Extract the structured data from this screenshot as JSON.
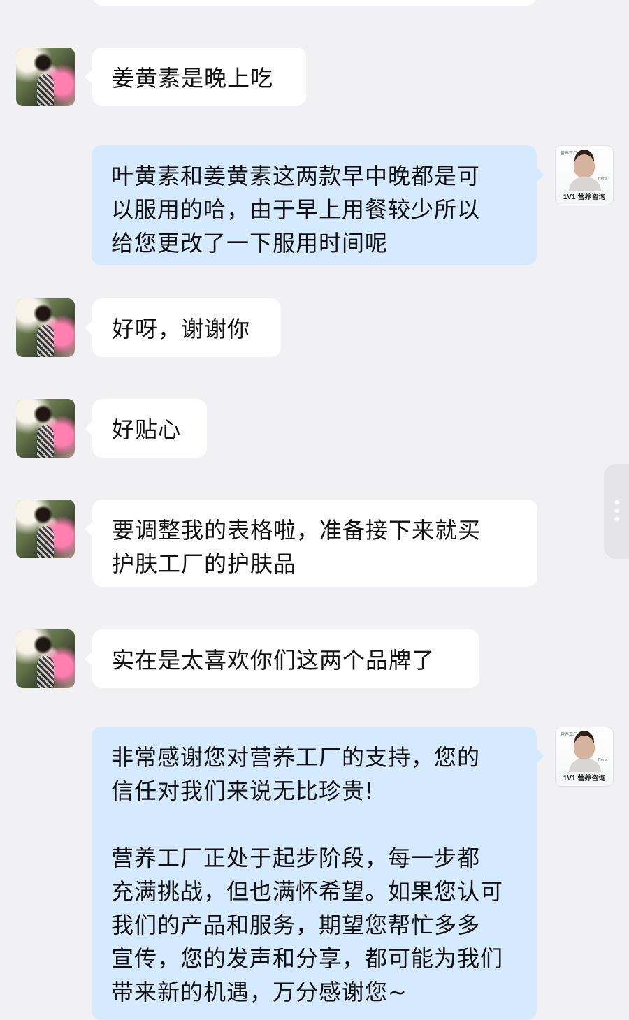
{
  "chat": {
    "messages": [
      {
        "id": "m1",
        "sender": "user",
        "text": "姜黄素是晚上吃"
      },
      {
        "id": "m2",
        "sender": "agent",
        "text": "叶黄素和姜黄素这两款早中晚都是可\n以服用的哈，由于早上用餐较少所以\n给您更改了一下服用时间呢"
      },
      {
        "id": "m3",
        "sender": "user",
        "text": "好呀，谢谢你"
      },
      {
        "id": "m4",
        "sender": "user",
        "text": "好贴心"
      },
      {
        "id": "m5",
        "sender": "user",
        "text": "要调整我的表格啦，准备接下来就买\n护肤工厂的护肤品"
      },
      {
        "id": "m6",
        "sender": "user",
        "text": "实在是太喜欢你们这两个品牌了"
      },
      {
        "id": "m7",
        "sender": "agent",
        "text": "非常感谢您对营养工厂的支持，您的\n信任对我们来说无比珍贵!\n\n营养工厂正处于起步阶段，每一步都\n充满挑战，但也满怀希望。如果您认可\n我们的产品和服务，期望您帮忙多多\n宣传，您的发声和分享，都可能为我们\n带来新的机遇，万分感谢您~"
      }
    ]
  },
  "agent_avatar": {
    "brand": "营养工厂",
    "name": "Fiona",
    "caption": "1V1 营养咨询"
  },
  "side_handle": {
    "icon": "more-vertical-icon",
    "glyph": "•\n•\n•"
  },
  "colors": {
    "background": "#f1f1f3",
    "user_bubble": "#ffffff",
    "agent_bubble": "#d6eaff",
    "text": "#111111"
  }
}
